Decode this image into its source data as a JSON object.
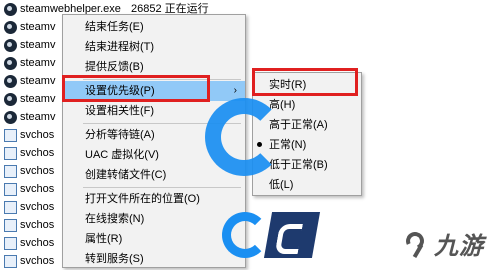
{
  "background": {
    "first_row_extra": "26852    正在运行",
    "processes": [
      {
        "icon": "steam-icon",
        "name": "steamwebhelper.exe"
      },
      {
        "icon": "steam-icon",
        "name": "steamv"
      },
      {
        "icon": "steam-icon",
        "name": "steamv"
      },
      {
        "icon": "steam-icon",
        "name": "steamv"
      },
      {
        "icon": "steam-icon",
        "name": "steamv"
      },
      {
        "icon": "steam-icon",
        "name": "steamv"
      },
      {
        "icon": "steam-icon",
        "name": "steamv"
      },
      {
        "icon": "service-icon",
        "name": "svchos"
      },
      {
        "icon": "service-icon",
        "name": "svchos"
      },
      {
        "icon": "service-icon",
        "name": "svchos"
      },
      {
        "icon": "service-icon",
        "name": "svchos"
      },
      {
        "icon": "service-icon",
        "name": "svchos"
      },
      {
        "icon": "service-icon",
        "name": "svchos"
      },
      {
        "icon": "service-icon",
        "name": "svchos"
      },
      {
        "icon": "service-icon",
        "name": "svchos"
      }
    ]
  },
  "context_menu": {
    "end_task": "结束任务(E)",
    "end_process_tree": "结束进程树(T)",
    "provide_feedback": "提供反馈(B)",
    "set_priority": "设置优先级(P)",
    "set_affinity": "设置相关性(F)",
    "analyze_wait_chain": "分析等待链(A)",
    "uac_virtualization": "UAC 虚拟化(V)",
    "create_dump": "创建转储文件(C)",
    "open_file_location": "打开文件所在的位置(O)",
    "search_online": "在线搜索(N)",
    "properties": "属性(R)",
    "go_to_services": "转到服务(S)",
    "submenu_arrow": "›"
  },
  "priority_submenu": {
    "realtime": "实时(R)",
    "high": "高(H)",
    "above_normal": "高于正常(A)",
    "normal": "正常(N)",
    "below_normal": "低于正常(B)",
    "low": "低(L)",
    "selected": "normal"
  },
  "watermark": {
    "brand_text": "九游"
  },
  "colors": {
    "highlight_box": "#e02020",
    "menu_active": "#91c9f7",
    "logo_blue": "#1a8ff2"
  }
}
